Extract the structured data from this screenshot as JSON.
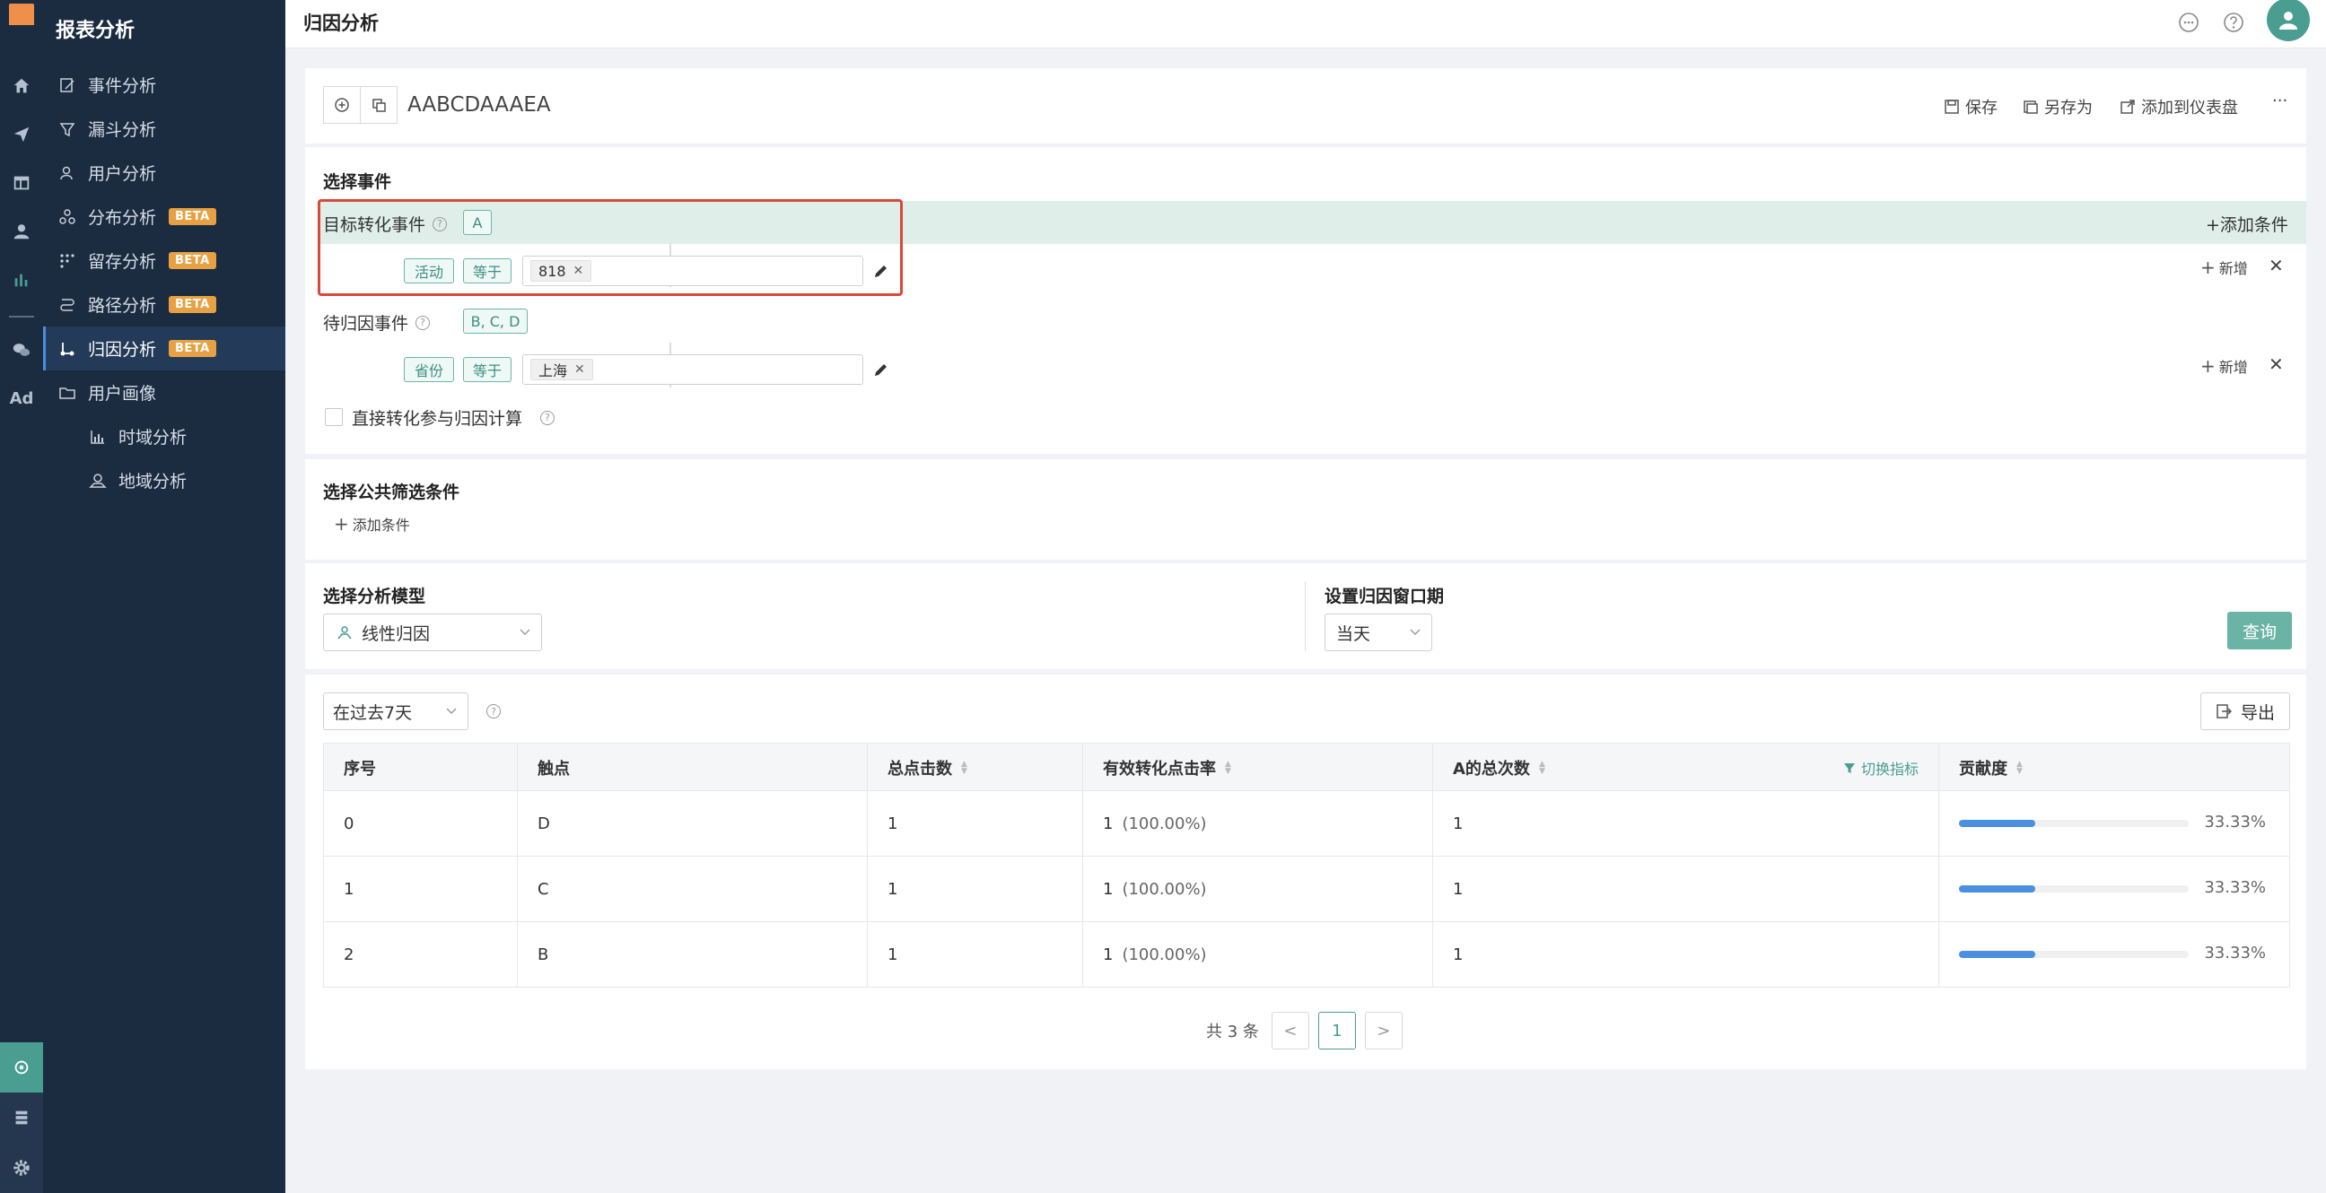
{
  "app": {
    "section_title": "报表分析",
    "page_title": "归因分析"
  },
  "sidebar": {
    "items": [
      {
        "label": "事件分析"
      },
      {
        "label": "漏斗分析"
      },
      {
        "label": "用户分析"
      },
      {
        "label": "分布分析",
        "badge": "BETA"
      },
      {
        "label": "留存分析",
        "badge": "BETA"
      },
      {
        "label": "路径分析",
        "badge": "BETA"
      },
      {
        "label": "归因分析",
        "badge": "BETA",
        "active": true
      },
      {
        "label": "用户画像"
      },
      {
        "label": "时域分析"
      },
      {
        "label": "地域分析"
      }
    ]
  },
  "rail": {
    "ad_label": "Ad"
  },
  "report": {
    "name": "AABCDAAAEA",
    "actions": {
      "save": "保存",
      "save_as": "另存为",
      "add_dashboard": "添加到仪表盘",
      "more": "···"
    }
  },
  "events": {
    "title": "选择事件",
    "target": {
      "label": "目标转化事件",
      "tag": "A",
      "add_condition": "+添加条件",
      "filter": {
        "field": "活动",
        "op": "等于",
        "values": [
          "818"
        ]
      },
      "add": "新增"
    },
    "pending": {
      "label": "待归因事件",
      "tag": "B, C, D",
      "filter": {
        "field": "省份",
        "op": "等于",
        "values": [
          "上海"
        ]
      },
      "add": "新增"
    },
    "direct_label": "直接转化参与归因计算"
  },
  "filters": {
    "title": "选择公共筛选条件",
    "add": "添加条件"
  },
  "model": {
    "title": "选择分析模型",
    "value": "线性归因",
    "window_title": "设置归因窗口期",
    "window_value": "当天",
    "query": "查询"
  },
  "result": {
    "range": "在过去7天",
    "export": "导出",
    "switch_metric": "切换指标",
    "columns": [
      "序号",
      "触点",
      "总点击数",
      "有效转化点击率",
      "A的总次数",
      "贡献度"
    ],
    "rows": [
      {
        "idx": "0",
        "touch": "D",
        "clicks": "1",
        "rate_n": "1",
        "rate_p": "(100.00%)",
        "total": "1",
        "contrib": "33.33%",
        "contrib_value": 0.3333
      },
      {
        "idx": "1",
        "touch": "C",
        "clicks": "1",
        "rate_n": "1",
        "rate_p": "(100.00%)",
        "total": "1",
        "contrib": "33.33%",
        "contrib_value": 0.3333
      },
      {
        "idx": "2",
        "touch": "B",
        "clicks": "1",
        "rate_n": "1",
        "rate_p": "(100.00%)",
        "total": "1",
        "contrib": "33.33%",
        "contrib_value": 0.3333
      }
    ],
    "pagination": {
      "total_text": "共 3 条",
      "current": "1",
      "prev": "<",
      "next": ">"
    }
  },
  "colors": {
    "accent": "#4a9d91",
    "sidebar": "#1b2b40",
    "highlight_box": "#d8493b",
    "bar": "#4a8fe0",
    "beta": "#e8a142"
  }
}
